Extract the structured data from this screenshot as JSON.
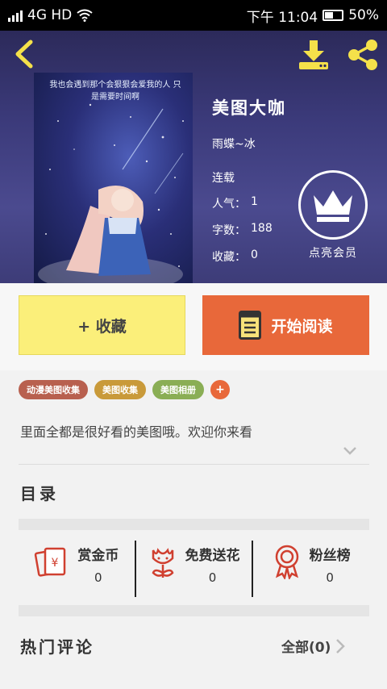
{
  "status_bar": {
    "network": "4G HD",
    "time": "下午 11:04",
    "battery_percent": "50%",
    "battery_level": 0.5
  },
  "header": {
    "back_icon": "chevron-left-icon",
    "download_icon": "download-icon",
    "share_icon": "share-icon",
    "accent_color": "#f5e14a"
  },
  "book": {
    "cover_caption": "我也会遇到那个会狠狠会爱我的人 只是需要时间啊",
    "title": "美图大咖",
    "author": "雨蝶~冰",
    "status": "连载",
    "popularity_label": "人气：",
    "popularity_value": "1",
    "word_count_label": "字数：",
    "word_count_value": "188",
    "favorites_label": "收藏：",
    "favorites_value": "0"
  },
  "vip": {
    "label": "点亮会员",
    "icon": "crown-icon"
  },
  "actions": {
    "favorite_label": "+ 收藏",
    "read_label": "开始阅读",
    "read_icon": "book-icon",
    "favorite_color": "#fbef7a",
    "read_color": "#e8683a"
  },
  "tags": [
    {
      "label": "动漫美图收集",
      "color": "#b8604f"
    },
    {
      "label": "美图收集",
      "color": "#c99a3a"
    },
    {
      "label": "美图相册",
      "color": "#8aae55"
    },
    {
      "label": "+",
      "color": "#e8683a"
    }
  ],
  "description": "里面全都是很好看的美图哦。欢迎你来看",
  "catalog_title": "目录",
  "stats": [
    {
      "name": "赏金币",
      "value": "0",
      "icon": "red-envelope-icon"
    },
    {
      "name": "免费送花",
      "value": "0",
      "icon": "flower-icon"
    },
    {
      "name": "粉丝榜",
      "value": "0",
      "icon": "medal-icon"
    }
  ],
  "comments": {
    "title": "热门评论",
    "all_label": "全部(0)"
  }
}
